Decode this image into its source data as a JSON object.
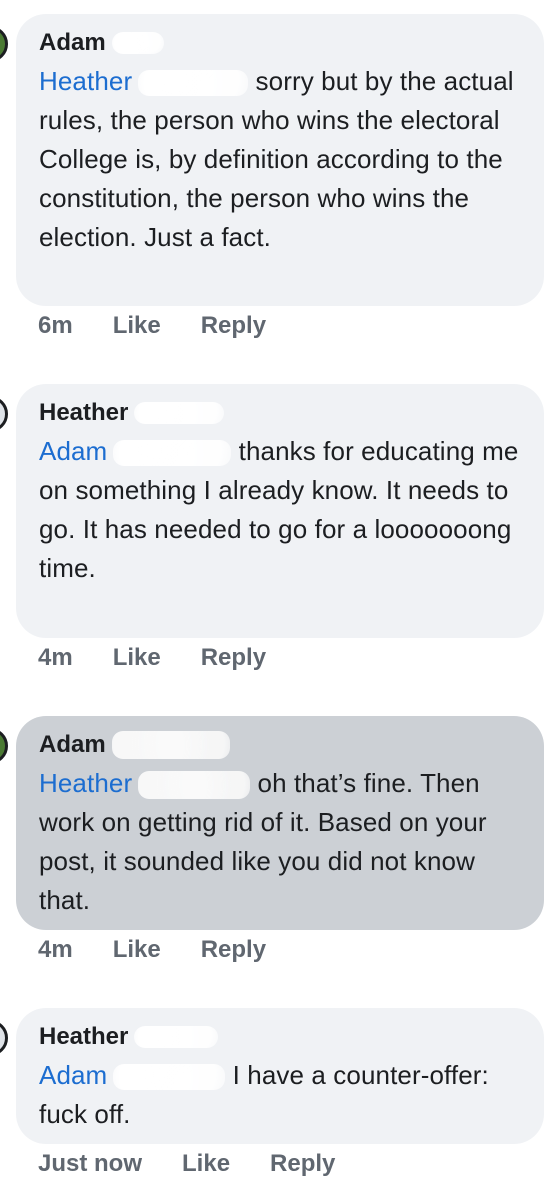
{
  "comments": [
    {
      "author": "Adam",
      "mention": "Heather",
      "body": "sorry but by the actual rules, the person who wins the electoral College is, by definition according to the constitution, the person who wins the election. Just a fact.",
      "time": "6m",
      "like_label": "Like",
      "reply_label": "Reply"
    },
    {
      "author": "Heather",
      "mention": "Adam",
      "body": "thanks for educating me on something I already know. It needs to go. It has needed to go for a looooooong time.",
      "time": "4m",
      "like_label": "Like",
      "reply_label": "Reply"
    },
    {
      "author": "Adam",
      "mention": "Heather",
      "body": "oh that’s fine. Then work on getting rid of it. Based on your post, it sounded like you did not know that.",
      "time": "4m",
      "like_label": "Like",
      "reply_label": "Reply"
    },
    {
      "author": "Heather",
      "mention": "Adam",
      "body": "I have a counter-offer: fuck off.",
      "time": "Just now",
      "like_label": "Like",
      "reply_label": "Reply"
    }
  ],
  "colors": {
    "bubble": "#f0f2f5",
    "bubble_highlight": "#ccd0d5",
    "mention": "#1c6dd0",
    "meta": "#606770"
  }
}
